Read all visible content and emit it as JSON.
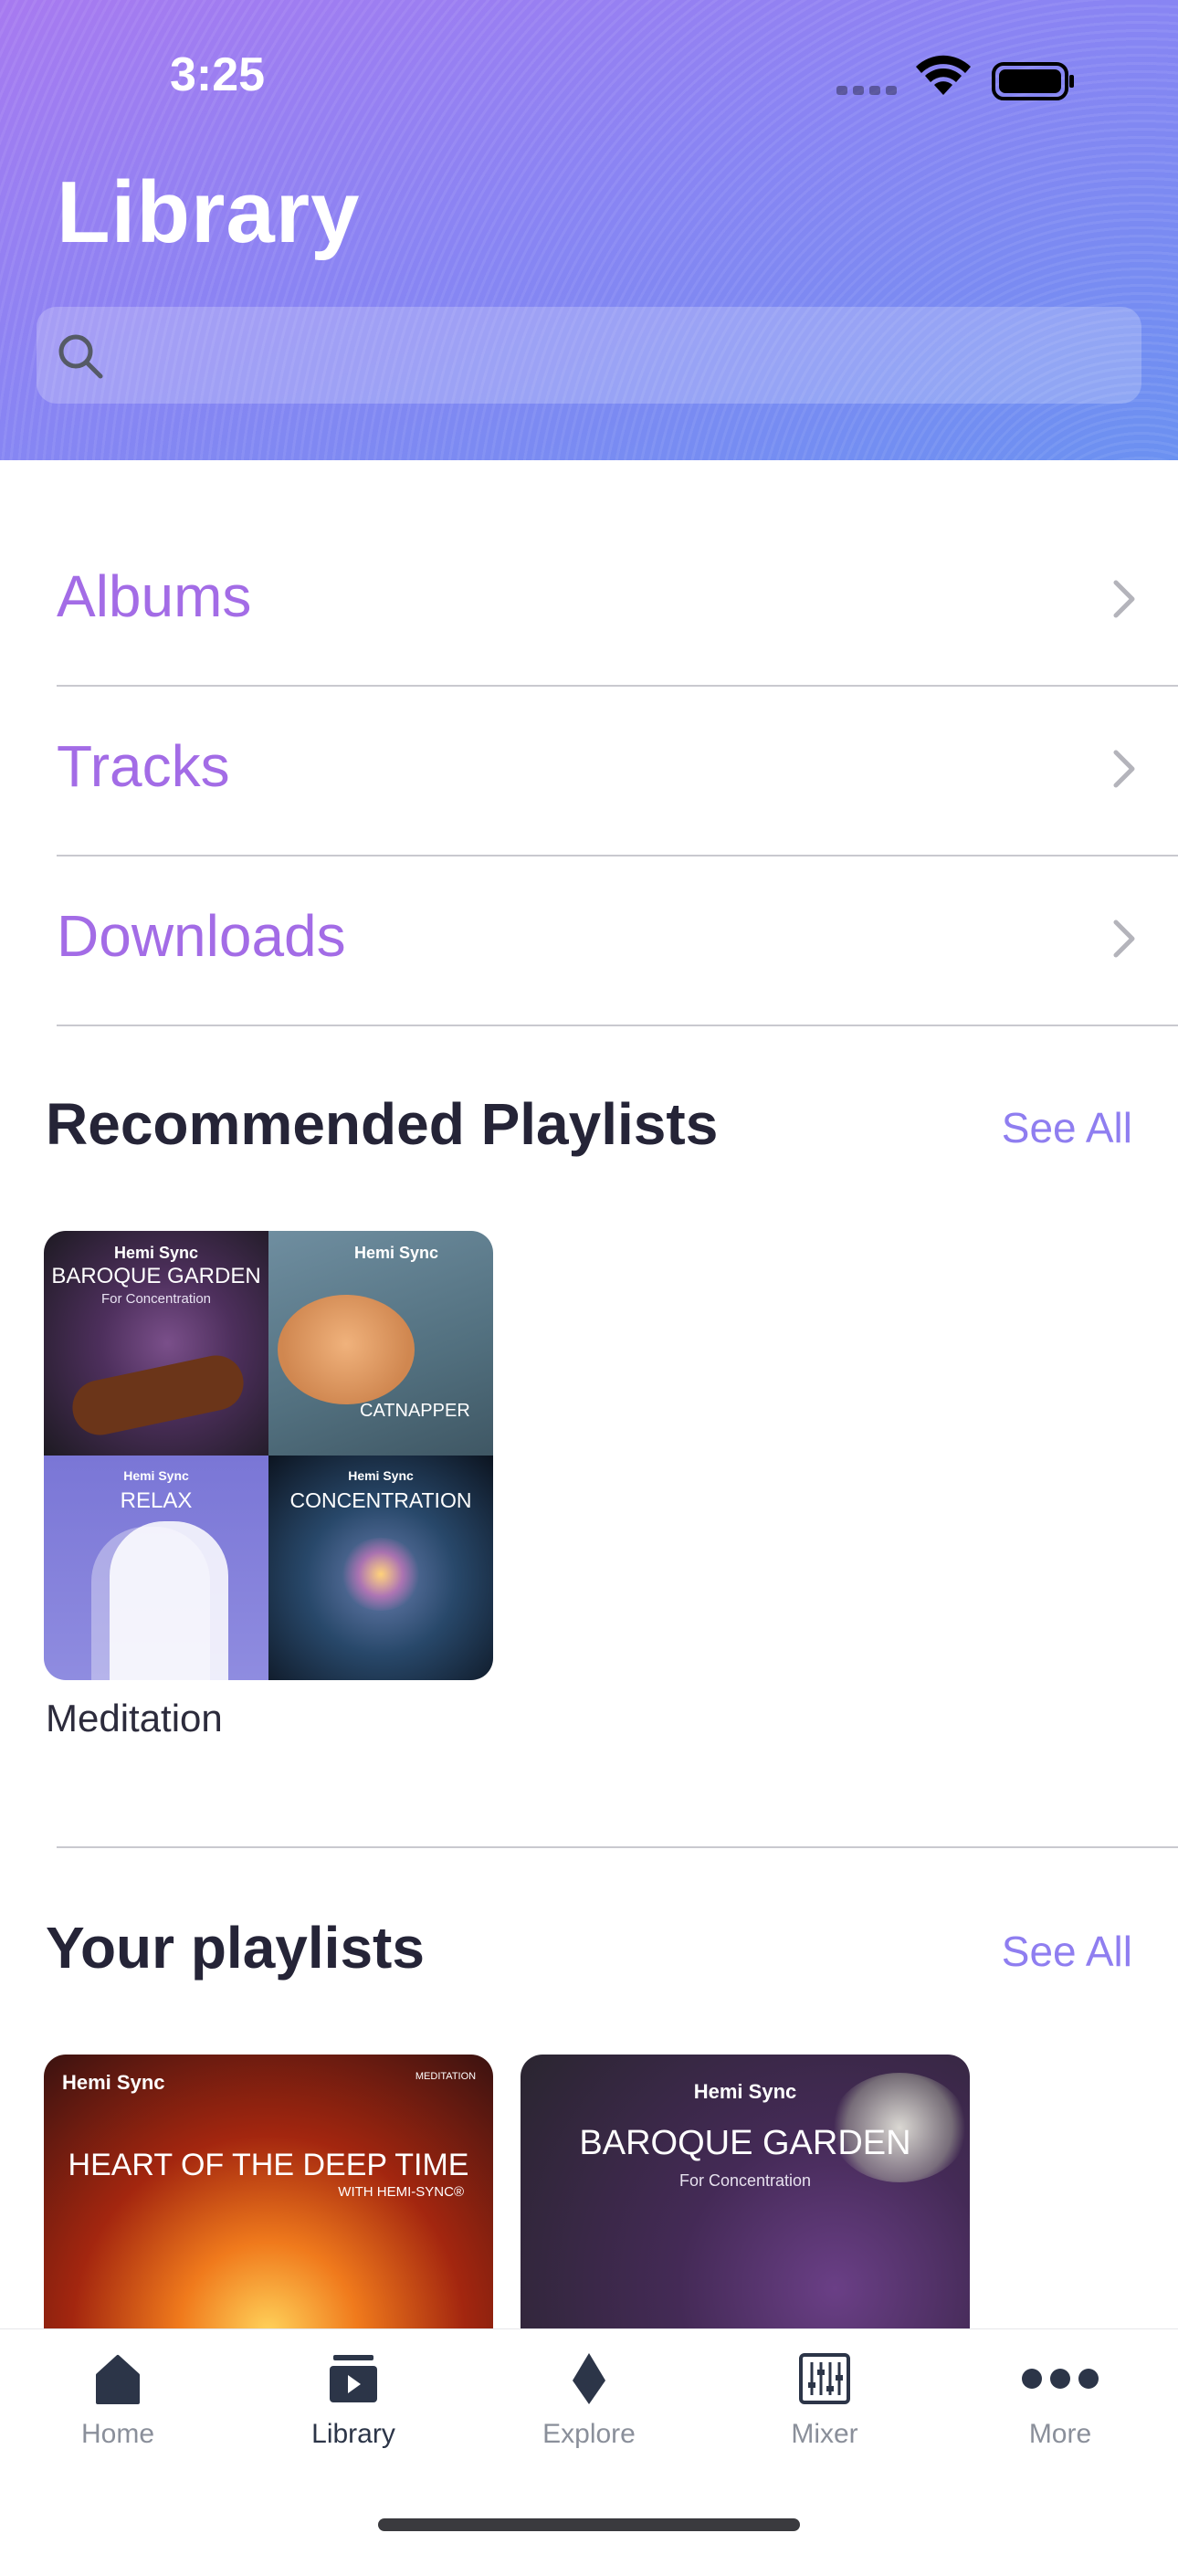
{
  "status_bar": {
    "time": "3:25"
  },
  "header": {
    "title": "Library",
    "search_placeholder": ""
  },
  "menu": [
    {
      "label": "Albums"
    },
    {
      "label": "Tracks"
    },
    {
      "label": "Downloads"
    }
  ],
  "recommended": {
    "title": "Recommended Playlists",
    "see_all": "See All",
    "playlist": {
      "name": "Meditation",
      "brand": "Hemi Sync",
      "covers": [
        {
          "title": "BAROQUE GARDEN",
          "subtitle": "For Concentration"
        },
        {
          "title": "CATNAPPER"
        },
        {
          "title": "RELAX"
        },
        {
          "title": "CONCENTRATION"
        }
      ]
    }
  },
  "yours": {
    "title": "Your playlists",
    "see_all": "See All",
    "playlists": [
      {
        "brand": "Hemi Sync",
        "title": "HEART OF THE DEEP TIME",
        "subtitle": "WITH HEMI-SYNC®",
        "badge": "MEDITATION"
      },
      {
        "brand": "Hemi Sync",
        "title": "BAROQUE GARDEN",
        "subtitle": "For Concentration"
      }
    ]
  },
  "tabs": [
    {
      "label": "Home",
      "icon": "home-icon"
    },
    {
      "label": "Library",
      "icon": "library-icon",
      "active": true
    },
    {
      "label": "Explore",
      "icon": "explore-icon"
    },
    {
      "label": "Mixer",
      "icon": "mixer-icon"
    },
    {
      "label": "More",
      "icon": "more-icon"
    }
  ],
  "colors": {
    "accent": "#a36ce6",
    "see_all": "#8f7ef0",
    "tab_active": "#2c3548",
    "tab_inactive": "#8a8f9a"
  }
}
